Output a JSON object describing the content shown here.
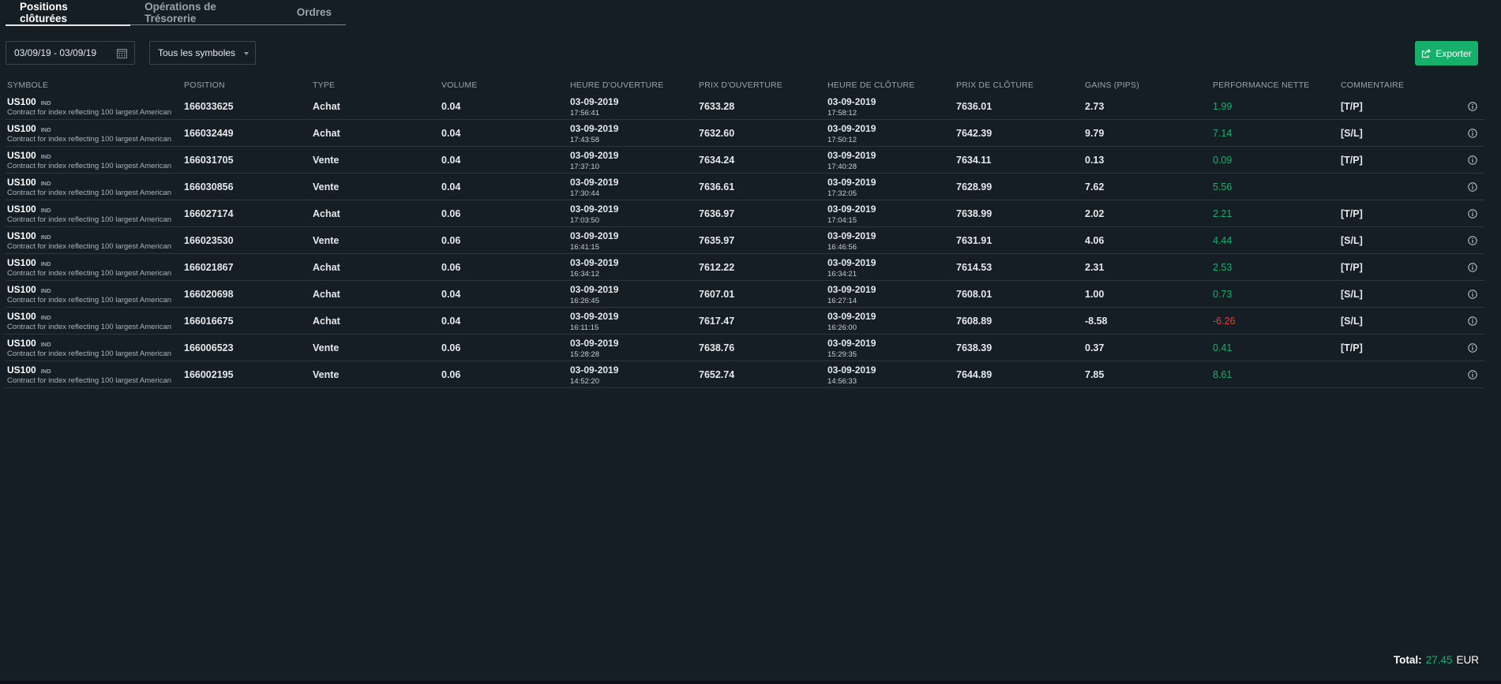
{
  "tabs": [
    {
      "label": "Positions clôturées",
      "active": true
    },
    {
      "label": "Opérations de Trésorerie",
      "active": false
    },
    {
      "label": "Ordres",
      "active": false
    }
  ],
  "filters": {
    "date_range": "03/09/19 - 03/09/19",
    "symbol_select": "Tous les symboles",
    "export_label": "Exporter"
  },
  "table": {
    "headers": {
      "symbol": "SYMBOLE",
      "position": "POSITION",
      "type": "TYPE",
      "volume": "VOLUME",
      "open_time": "HEURE D'OUVERTURE",
      "open_price": "PRIX D'OUVERTURE",
      "close_time": "HEURE DE CLÔTURE",
      "close_price": "PRIX DE CLÔTURE",
      "gain": "GAINS (PIPS)",
      "perf": "PERFORMANCE NETTE",
      "comment": "COMMENTAIRE"
    },
    "rows": [
      {
        "symbol": "US100",
        "tag": "IND",
        "desc": "Contract for index reflecting 100 largest American",
        "position": "166033625",
        "type": "Achat",
        "volume": "0.04",
        "open_date": "03-09-2019",
        "open_time": "17:56:41",
        "open_price": "7633.28",
        "close_date": "03-09-2019",
        "close_time": "17:58:12",
        "close_price": "7636.01",
        "gain": "2.73",
        "perf": "1.99",
        "comment": "[T/P]"
      },
      {
        "symbol": "US100",
        "tag": "IND",
        "desc": "Contract for index reflecting 100 largest American",
        "position": "166032449",
        "type": "Achat",
        "volume": "0.04",
        "open_date": "03-09-2019",
        "open_time": "17:43:58",
        "open_price": "7632.60",
        "close_date": "03-09-2019",
        "close_time": "17:50:12",
        "close_price": "7642.39",
        "gain": "9.79",
        "perf": "7.14",
        "comment": "[S/L]"
      },
      {
        "symbol": "US100",
        "tag": "IND",
        "desc": "Contract for index reflecting 100 largest American",
        "position": "166031705",
        "type": "Vente",
        "volume": "0.04",
        "open_date": "03-09-2019",
        "open_time": "17:37:10",
        "open_price": "7634.24",
        "close_date": "03-09-2019",
        "close_time": "17:40:28",
        "close_price": "7634.11",
        "gain": "0.13",
        "perf": "0.09",
        "comment": "[T/P]"
      },
      {
        "symbol": "US100",
        "tag": "IND",
        "desc": "Contract for index reflecting 100 largest American",
        "position": "166030856",
        "type": "Vente",
        "volume": "0.04",
        "open_date": "03-09-2019",
        "open_time": "17:30:44",
        "open_price": "7636.61",
        "close_date": "03-09-2019",
        "close_time": "17:32:05",
        "close_price": "7628.99",
        "gain": "7.62",
        "perf": "5.56",
        "comment": ""
      },
      {
        "symbol": "US100",
        "tag": "IND",
        "desc": "Contract for index reflecting 100 largest American",
        "position": "166027174",
        "type": "Achat",
        "volume": "0.06",
        "open_date": "03-09-2019",
        "open_time": "17:03:50",
        "open_price": "7636.97",
        "close_date": "03-09-2019",
        "close_time": "17:04:15",
        "close_price": "7638.99",
        "gain": "2.02",
        "perf": "2.21",
        "comment": "[T/P]"
      },
      {
        "symbol": "US100",
        "tag": "IND",
        "desc": "Contract for index reflecting 100 largest American",
        "position": "166023530",
        "type": "Vente",
        "volume": "0.06",
        "open_date": "03-09-2019",
        "open_time": "16:41:15",
        "open_price": "7635.97",
        "close_date": "03-09-2019",
        "close_time": "16:46:56",
        "close_price": "7631.91",
        "gain": "4.06",
        "perf": "4.44",
        "comment": "[S/L]"
      },
      {
        "symbol": "US100",
        "tag": "IND",
        "desc": "Contract for index reflecting 100 largest American",
        "position": "166021867",
        "type": "Achat",
        "volume": "0.06",
        "open_date": "03-09-2019",
        "open_time": "16:34:12",
        "open_price": "7612.22",
        "close_date": "03-09-2019",
        "close_time": "16:34:21",
        "close_price": "7614.53",
        "gain": "2.31",
        "perf": "2.53",
        "comment": "[T/P]"
      },
      {
        "symbol": "US100",
        "tag": "IND",
        "desc": "Contract for index reflecting 100 largest American",
        "position": "166020698",
        "type": "Achat",
        "volume": "0.04",
        "open_date": "03-09-2019",
        "open_time": "16:26:45",
        "open_price": "7607.01",
        "close_date": "03-09-2019",
        "close_time": "16:27:14",
        "close_price": "7608.01",
        "gain": "1.00",
        "perf": "0.73",
        "comment": "[S/L]"
      },
      {
        "symbol": "US100",
        "tag": "IND",
        "desc": "Contract for index reflecting 100 largest American",
        "position": "166016675",
        "type": "Achat",
        "volume": "0.04",
        "open_date": "03-09-2019",
        "open_time": "16:11:15",
        "open_price": "7617.47",
        "close_date": "03-09-2019",
        "close_time": "16:26:00",
        "close_price": "7608.89",
        "gain": "-8.58",
        "perf": "-6.26",
        "comment": "[S/L]"
      },
      {
        "symbol": "US100",
        "tag": "IND",
        "desc": "Contract for index reflecting 100 largest American",
        "position": "166006523",
        "type": "Vente",
        "volume": "0.06",
        "open_date": "03-09-2019",
        "open_time": "15:28:28",
        "open_price": "7638.76",
        "close_date": "03-09-2019",
        "close_time": "15:29:35",
        "close_price": "7638.39",
        "gain": "0.37",
        "perf": "0.41",
        "comment": "[T/P]"
      },
      {
        "symbol": "US100",
        "tag": "IND",
        "desc": "Contract for index reflecting 100 largest American",
        "position": "166002195",
        "type": "Vente",
        "volume": "0.06",
        "open_date": "03-09-2019",
        "open_time": "14:52:20",
        "open_price": "7652.74",
        "close_date": "03-09-2019",
        "close_time": "14:56:33",
        "close_price": "7644.89",
        "gain": "7.85",
        "perf": "8.61",
        "comment": ""
      }
    ]
  },
  "footer": {
    "total_label": "Total:",
    "total_value": "27.45",
    "currency": "EUR"
  },
  "colors": {
    "positive": "#17b06a",
    "negative": "#e0433d",
    "accent": "#17b06a"
  }
}
